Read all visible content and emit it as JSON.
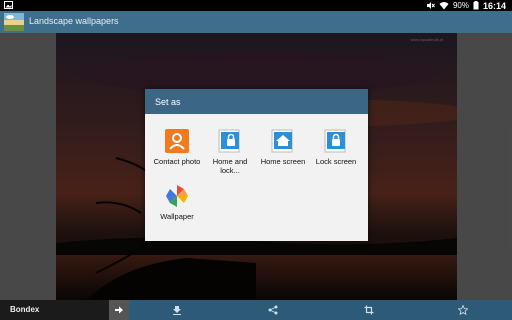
{
  "status_bar": {
    "battery_percent": "90%",
    "time": "16:14",
    "icons": [
      "gallery-icon",
      "mute-icon",
      "wifi-icon",
      "battery-icon"
    ]
  },
  "action_bar": {
    "title": "Landscape wallpapers"
  },
  "content": {
    "watermark": "www.hqwallbuilt.pt"
  },
  "dialog": {
    "title": "Set as",
    "items": [
      {
        "label": "Contact photo",
        "icon": "contact-icon"
      },
      {
        "label": "Home and lock...",
        "icon": "home-lock-icon"
      },
      {
        "label": "Home screen",
        "icon": "home-icon"
      },
      {
        "label": "Lock screen",
        "icon": "lock-icon"
      },
      {
        "label": "Wallpaper",
        "icon": "pinwheel-icon"
      }
    ]
  },
  "bottom_bar": {
    "label": "Bondex",
    "icons": [
      "arrow-right-icon",
      "download-icon",
      "share-icon",
      "crop-icon",
      "star-icon"
    ]
  },
  "colors": {
    "action_bar": "#3f6e8c",
    "dialog_title": "#3d6584",
    "bottom_bar": "#2d5a77",
    "contact_orange": "#f07a1f"
  }
}
